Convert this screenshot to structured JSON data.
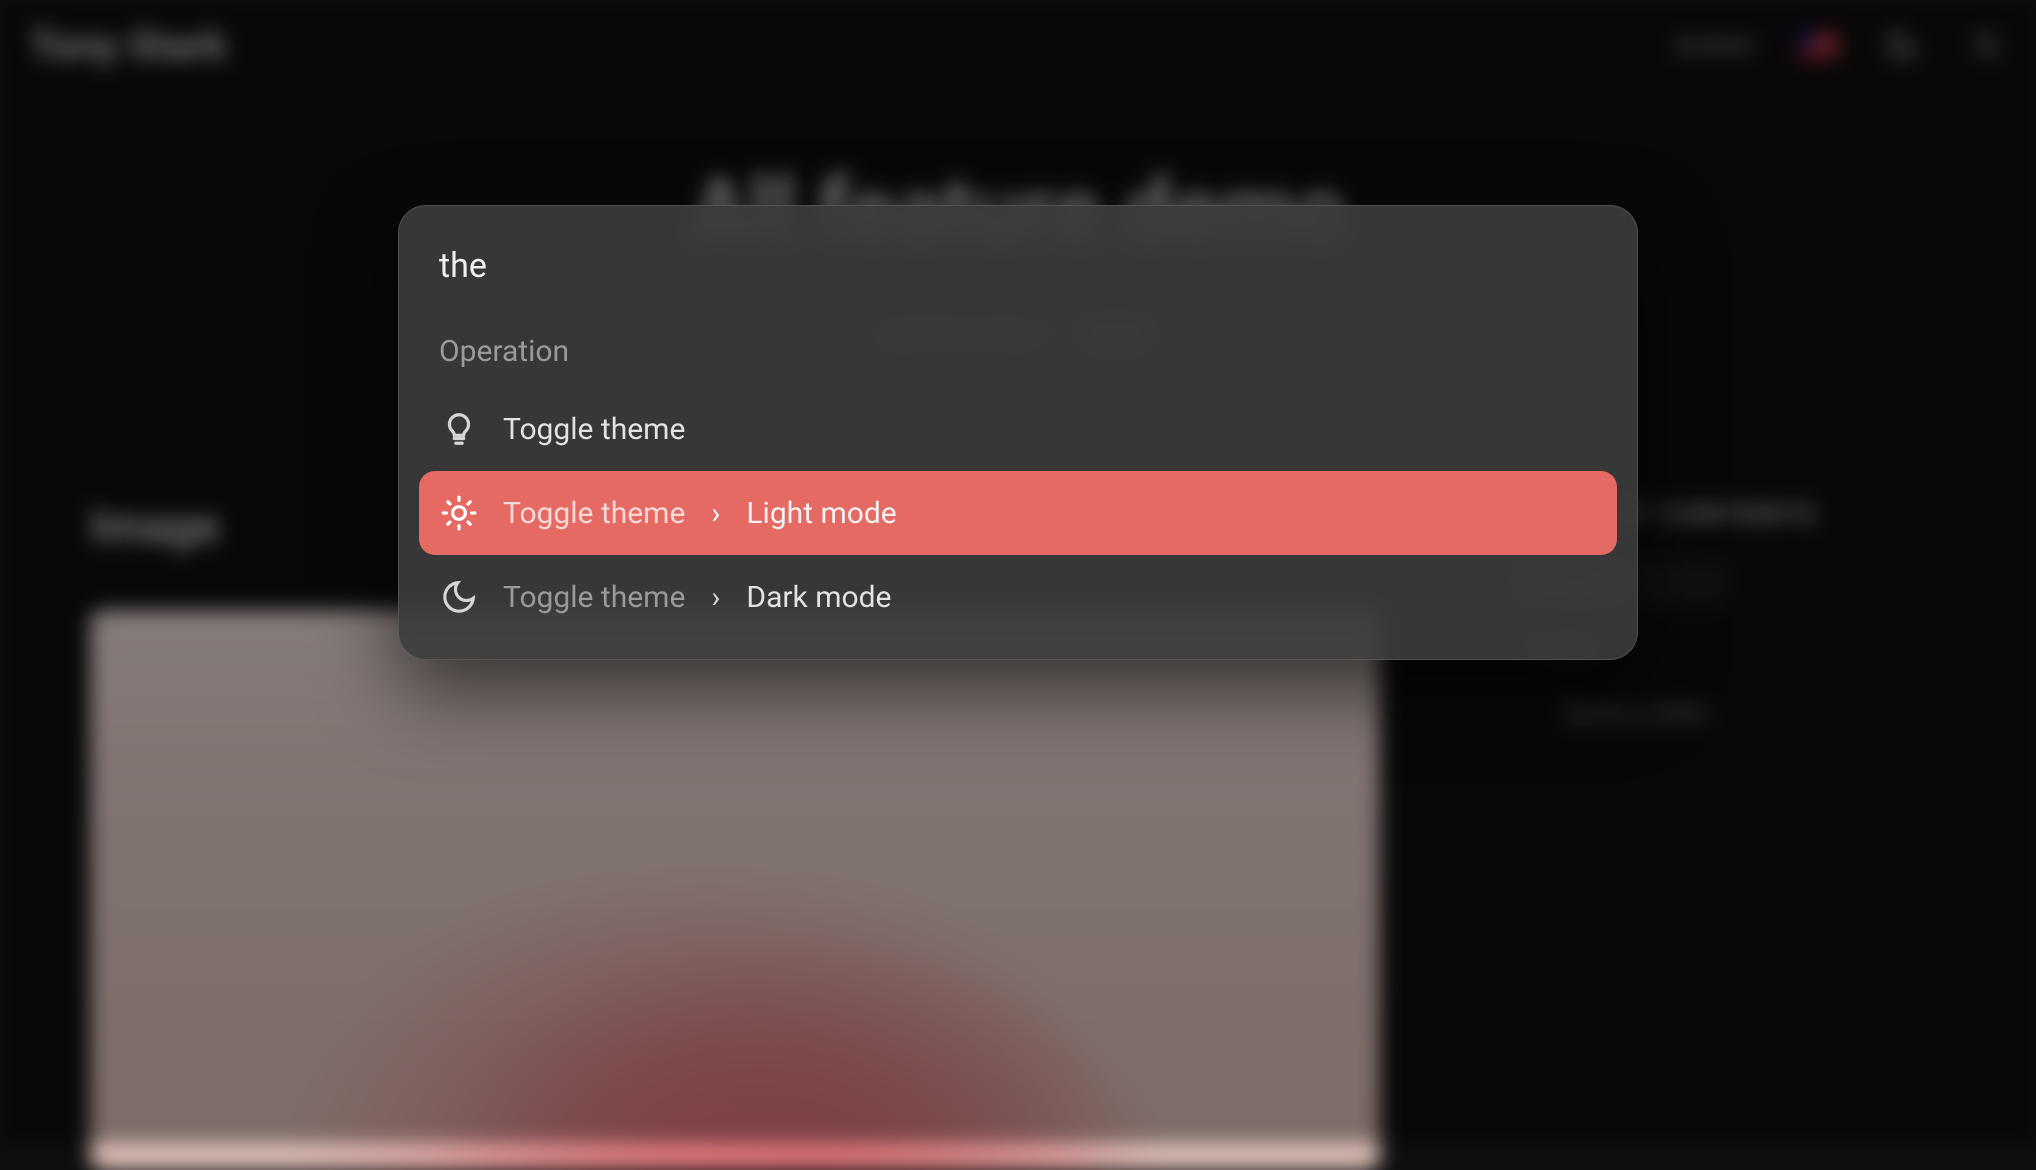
{
  "header": {
    "brand": "Tony Stark",
    "nav_link": "Archive"
  },
  "hero": {
    "title": "All feature demo",
    "subtitle_prefix": "Updated: Sep 7",
    "subtitle_badge": "2024"
  },
  "section": {
    "image_label": "Image"
  },
  "toc": {
    "title": "TABLE OF CONTENTS",
    "items": [
      {
        "label": "Image",
        "level": 1,
        "active": true
      },
      {
        "label": "Audio",
        "level": 1,
        "active": false
      },
      {
        "label": "Series codes",
        "level": 2,
        "active": false
      }
    ]
  },
  "palette": {
    "input_value": "the",
    "group_label": "Operation",
    "items": [
      {
        "icon": "bulb",
        "crumb": "Toggle theme",
        "leaf": "",
        "selected": false
      },
      {
        "icon": "sun",
        "crumb": "Toggle theme",
        "leaf": "Light mode",
        "selected": true
      },
      {
        "icon": "moon",
        "crumb": "Toggle theme",
        "leaf": "Dark mode",
        "selected": false
      }
    ],
    "chevron": "›"
  },
  "colors": {
    "accent": "#e56a63"
  }
}
